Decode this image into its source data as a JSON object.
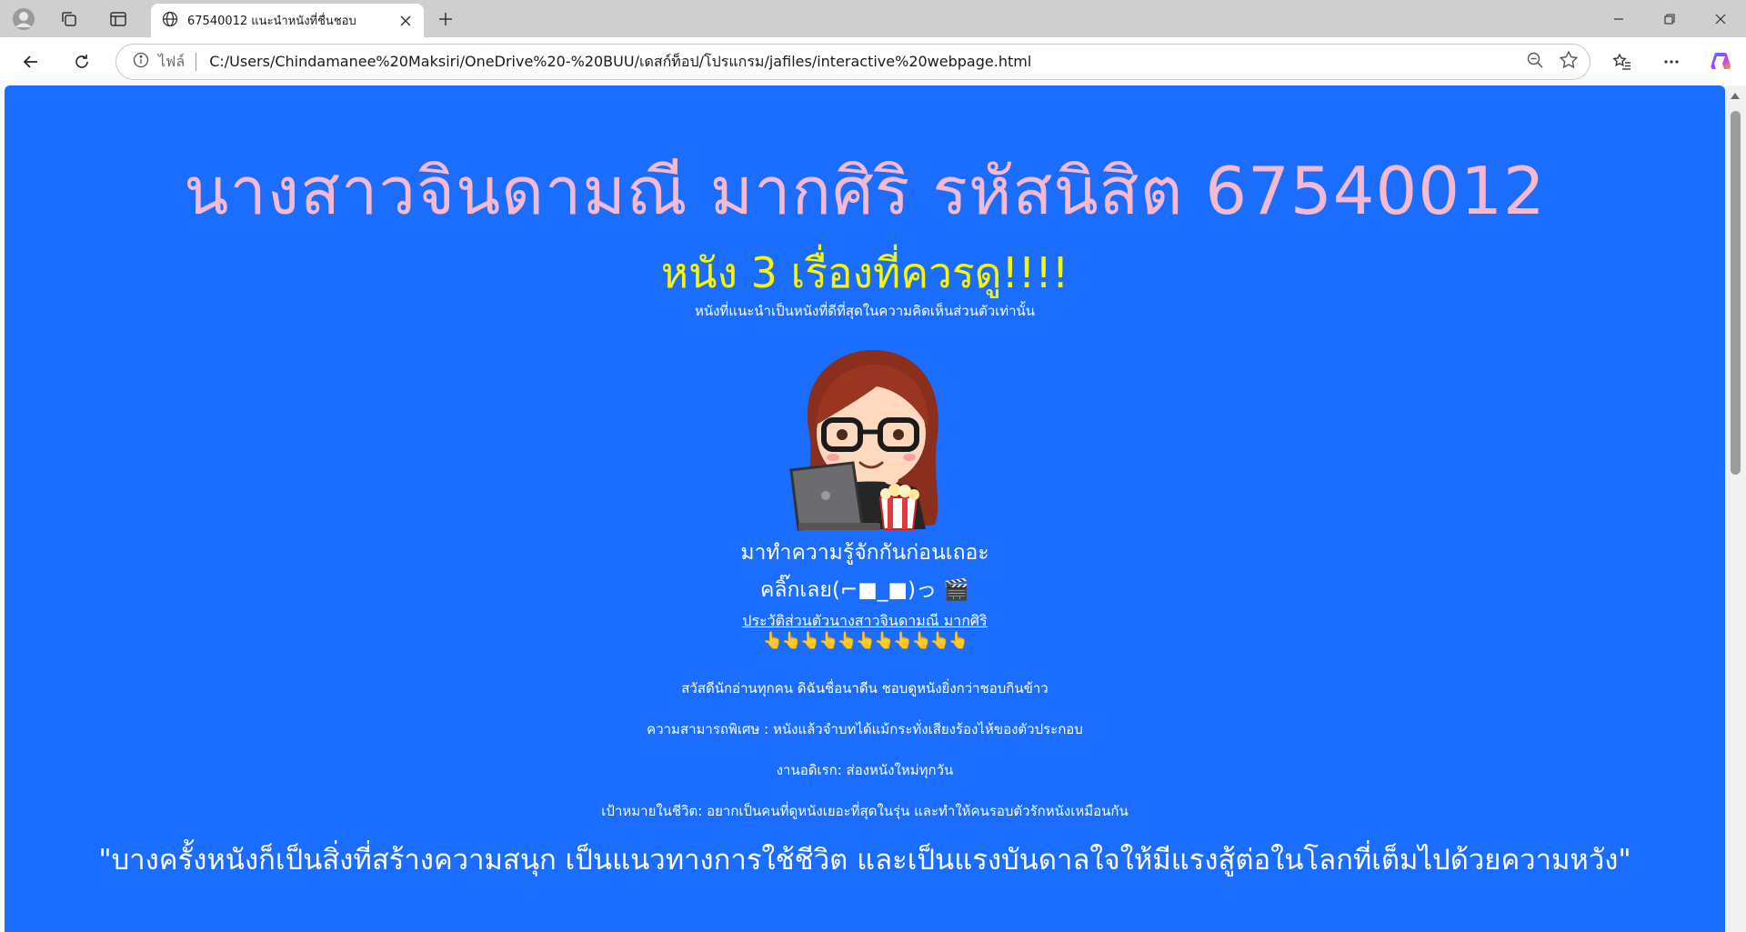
{
  "browser": {
    "tab_title": "67540012 แนะนำหนังที่ชื่นชอบ",
    "address_label": "ไฟล์",
    "url": "C:/Users/Chindamanee%20Maksiri/OneDrive%20-%20BUU/เดสก์ท็อป/โปรแกรม/jafiles/interactive%20webpage.html"
  },
  "page": {
    "headline": "นางสาวจินดามณี มากศิริ รหัสนิสิต 67540012",
    "subhead": "หนัง 3 เรื่องที่ควรดู!!!!",
    "note": "หนังที่แนะนำเป็นหนังที่ดีที่สุดในความคิดเห็นส่วนตัวเท่านั้น",
    "intro_line_1": "มาทำความรู้จักกันก่อนเถอะ",
    "intro_line_2": "คลิ๊กเลย(⌐■_■)っ 🎬",
    "bio_link": "ประวัติส่วนตัวนางสาวจินดามณี มากศิริ",
    "pointers": "👆👆👆👆👆👆👆👆👆👆👆",
    "para_1": "สวัสดีนักอ่านทุกคน ดิฉันชื่อนาดีน ชอบดูหนังยิ่งกว่าชอบกินข้าว",
    "para_2": "ความสามารถพิเศษ : หนังแล้วจำบทได้แม้กระทั่งเสียงร้องไห้ของตัวประกอบ",
    "para_3": "งานอดิเรก: ส่องหนังใหม่ทุกวัน",
    "para_4": "เป้าหมายในชีวิต: อยากเป็นคนที่ดูหนังเยอะที่สุดในรุ่น และทำให้คนรอบตัวรักหนังเหมือนกัน",
    "quote": "\"บางครั้งหนังก็เป็นสิ่งที่สร้างความสนุก เป็นแนวทางการใช้ชีวิต และเป็นแรงบันดาลใจให้มีแรงสู้ต่อในโลกที่เต็มไปด้วยความหวัง\""
  },
  "icons": {
    "profile": "profile-icon",
    "workspaces": "workspaces-icon",
    "tab_actions": "tab-actions-icon",
    "globe": "globe-icon",
    "close": "close-icon",
    "new_tab": "plus-icon",
    "back": "back-arrow-icon",
    "refresh": "refresh-icon",
    "info": "info-icon",
    "zoom": "zoom-out-icon",
    "favorite": "star-icon",
    "favorites": "favorites-icon",
    "more": "more-icon",
    "copilot": "copilot-icon"
  },
  "colors": {
    "page_background": "#1a6dff",
    "headline": "#f7b9d2",
    "subhead": "#f7f700",
    "text": "#ffffff"
  }
}
